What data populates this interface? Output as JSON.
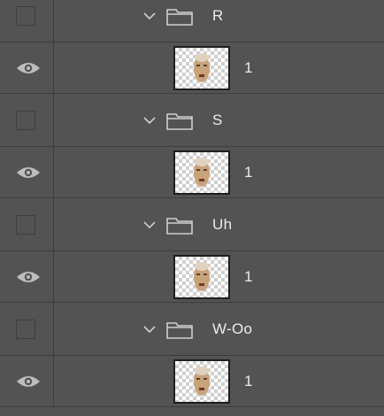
{
  "layers_panel": {
    "rows": [
      {
        "type": "group",
        "name": "R",
        "visible": false,
        "expanded": true
      },
      {
        "type": "layer",
        "name": "1",
        "visible": true,
        "thumbnail": "face-thumbnail"
      },
      {
        "type": "group",
        "name": "S",
        "visible": false,
        "expanded": true
      },
      {
        "type": "layer",
        "name": "1",
        "visible": true,
        "thumbnail": "face-thumbnail"
      },
      {
        "type": "group",
        "name": "Uh",
        "visible": false,
        "expanded": true
      },
      {
        "type": "layer",
        "name": "1",
        "visible": true,
        "thumbnail": "face-thumbnail"
      },
      {
        "type": "group",
        "name": "W-Oo",
        "visible": false,
        "expanded": true
      },
      {
        "type": "layer",
        "name": "1",
        "visible": true,
        "thumbnail": "face-thumbnail"
      }
    ]
  },
  "icons": {
    "visibility_on": "eye-icon",
    "visibility_off": "empty-visibility-box",
    "expand": "chevron-down-icon",
    "group": "folder-icon"
  },
  "colors": {
    "panel_bg": "#535353",
    "divider": "#3c3c3c",
    "text": "#ececec",
    "icon": "#c8c8c8"
  }
}
